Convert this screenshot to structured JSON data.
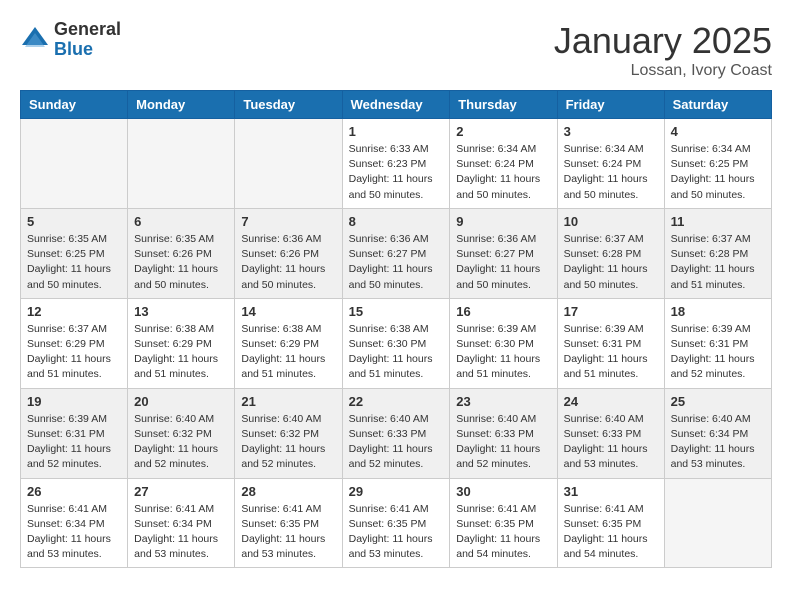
{
  "logo": {
    "general": "General",
    "blue": "Blue"
  },
  "title": "January 2025",
  "location": "Lossan, Ivory Coast",
  "days_of_week": [
    "Sunday",
    "Monday",
    "Tuesday",
    "Wednesday",
    "Thursday",
    "Friday",
    "Saturday"
  ],
  "weeks": [
    [
      {
        "day": "",
        "info": ""
      },
      {
        "day": "",
        "info": ""
      },
      {
        "day": "",
        "info": ""
      },
      {
        "day": "1",
        "info": "Sunrise: 6:33 AM\nSunset: 6:23 PM\nDaylight: 11 hours and 50 minutes."
      },
      {
        "day": "2",
        "info": "Sunrise: 6:34 AM\nSunset: 6:24 PM\nDaylight: 11 hours and 50 minutes."
      },
      {
        "day": "3",
        "info": "Sunrise: 6:34 AM\nSunset: 6:24 PM\nDaylight: 11 hours and 50 minutes."
      },
      {
        "day": "4",
        "info": "Sunrise: 6:34 AM\nSunset: 6:25 PM\nDaylight: 11 hours and 50 minutes."
      }
    ],
    [
      {
        "day": "5",
        "info": "Sunrise: 6:35 AM\nSunset: 6:25 PM\nDaylight: 11 hours and 50 minutes."
      },
      {
        "day": "6",
        "info": "Sunrise: 6:35 AM\nSunset: 6:26 PM\nDaylight: 11 hours and 50 minutes."
      },
      {
        "day": "7",
        "info": "Sunrise: 6:36 AM\nSunset: 6:26 PM\nDaylight: 11 hours and 50 minutes."
      },
      {
        "day": "8",
        "info": "Sunrise: 6:36 AM\nSunset: 6:27 PM\nDaylight: 11 hours and 50 minutes."
      },
      {
        "day": "9",
        "info": "Sunrise: 6:36 AM\nSunset: 6:27 PM\nDaylight: 11 hours and 50 minutes."
      },
      {
        "day": "10",
        "info": "Sunrise: 6:37 AM\nSunset: 6:28 PM\nDaylight: 11 hours and 50 minutes."
      },
      {
        "day": "11",
        "info": "Sunrise: 6:37 AM\nSunset: 6:28 PM\nDaylight: 11 hours and 51 minutes."
      }
    ],
    [
      {
        "day": "12",
        "info": "Sunrise: 6:37 AM\nSunset: 6:29 PM\nDaylight: 11 hours and 51 minutes."
      },
      {
        "day": "13",
        "info": "Sunrise: 6:38 AM\nSunset: 6:29 PM\nDaylight: 11 hours and 51 minutes."
      },
      {
        "day": "14",
        "info": "Sunrise: 6:38 AM\nSunset: 6:29 PM\nDaylight: 11 hours and 51 minutes."
      },
      {
        "day": "15",
        "info": "Sunrise: 6:38 AM\nSunset: 6:30 PM\nDaylight: 11 hours and 51 minutes."
      },
      {
        "day": "16",
        "info": "Sunrise: 6:39 AM\nSunset: 6:30 PM\nDaylight: 11 hours and 51 minutes."
      },
      {
        "day": "17",
        "info": "Sunrise: 6:39 AM\nSunset: 6:31 PM\nDaylight: 11 hours and 51 minutes."
      },
      {
        "day": "18",
        "info": "Sunrise: 6:39 AM\nSunset: 6:31 PM\nDaylight: 11 hours and 52 minutes."
      }
    ],
    [
      {
        "day": "19",
        "info": "Sunrise: 6:39 AM\nSunset: 6:31 PM\nDaylight: 11 hours and 52 minutes."
      },
      {
        "day": "20",
        "info": "Sunrise: 6:40 AM\nSunset: 6:32 PM\nDaylight: 11 hours and 52 minutes."
      },
      {
        "day": "21",
        "info": "Sunrise: 6:40 AM\nSunset: 6:32 PM\nDaylight: 11 hours and 52 minutes."
      },
      {
        "day": "22",
        "info": "Sunrise: 6:40 AM\nSunset: 6:33 PM\nDaylight: 11 hours and 52 minutes."
      },
      {
        "day": "23",
        "info": "Sunrise: 6:40 AM\nSunset: 6:33 PM\nDaylight: 11 hours and 52 minutes."
      },
      {
        "day": "24",
        "info": "Sunrise: 6:40 AM\nSunset: 6:33 PM\nDaylight: 11 hours and 53 minutes."
      },
      {
        "day": "25",
        "info": "Sunrise: 6:40 AM\nSunset: 6:34 PM\nDaylight: 11 hours and 53 minutes."
      }
    ],
    [
      {
        "day": "26",
        "info": "Sunrise: 6:41 AM\nSunset: 6:34 PM\nDaylight: 11 hours and 53 minutes."
      },
      {
        "day": "27",
        "info": "Sunrise: 6:41 AM\nSunset: 6:34 PM\nDaylight: 11 hours and 53 minutes."
      },
      {
        "day": "28",
        "info": "Sunrise: 6:41 AM\nSunset: 6:35 PM\nDaylight: 11 hours and 53 minutes."
      },
      {
        "day": "29",
        "info": "Sunrise: 6:41 AM\nSunset: 6:35 PM\nDaylight: 11 hours and 53 minutes."
      },
      {
        "day": "30",
        "info": "Sunrise: 6:41 AM\nSunset: 6:35 PM\nDaylight: 11 hours and 54 minutes."
      },
      {
        "day": "31",
        "info": "Sunrise: 6:41 AM\nSunset: 6:35 PM\nDaylight: 11 hours and 54 minutes."
      },
      {
        "day": "",
        "info": ""
      }
    ]
  ]
}
